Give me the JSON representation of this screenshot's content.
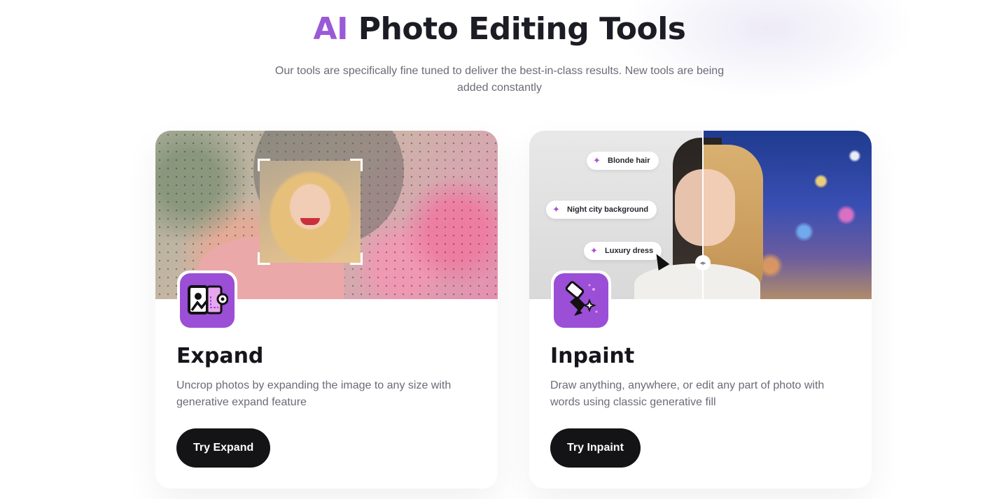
{
  "hero": {
    "title_accent": "AI",
    "title_rest": "Photo Editing Tools",
    "subtitle": "Our tools are specifically fine tuned to deliver the best-in-class results. New tools are being added constantly"
  },
  "cards": [
    {
      "title": "Expand",
      "description": "Uncrop photos by expanding the image to any size with generative expand feature",
      "button_label": "Try Expand",
      "icon": "expand-icon"
    },
    {
      "title": "Inpaint",
      "description": "Draw anything, anywhere, or edit any part of photo with words using classic generative fill",
      "button_label": "Try Inpaint",
      "icon": "brush-icon",
      "chips": [
        "Blonde hair",
        "Night city background",
        "Luxury dress"
      ]
    }
  ],
  "colors": {
    "accent": "#9a5ad6",
    "icon_bg": "#9b4ed6",
    "button_bg": "#141417"
  }
}
